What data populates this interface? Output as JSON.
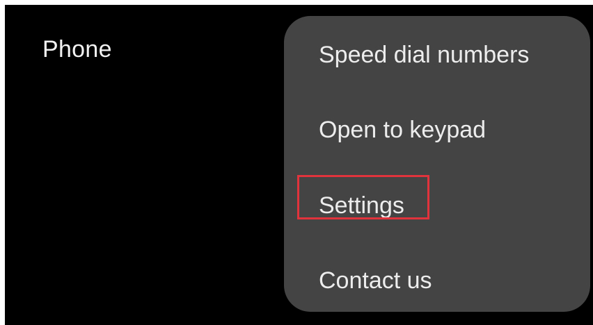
{
  "app": {
    "title": "Phone"
  },
  "overflow_menu": {
    "items": [
      {
        "label": "Speed dial numbers"
      },
      {
        "label": "Open to keypad"
      },
      {
        "label": "Settings",
        "highlighted": true
      },
      {
        "label": "Contact us"
      }
    ]
  },
  "colors": {
    "background": "#000000",
    "menu_surface": "#444444",
    "text": "#ededed",
    "highlight_outline": "#e0333c"
  }
}
